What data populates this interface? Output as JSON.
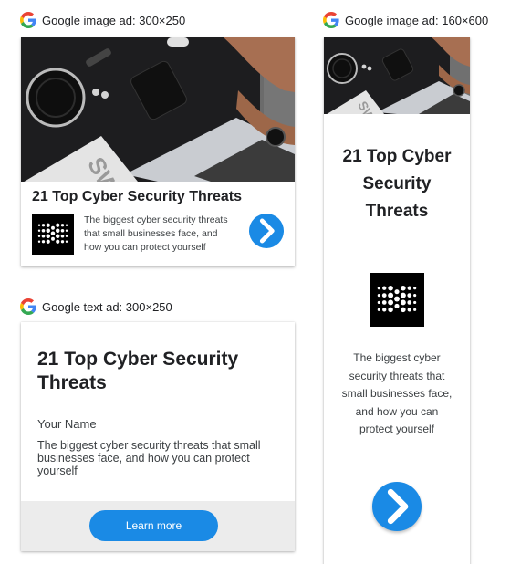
{
  "labels": {
    "image_ad_300": "Google image ad: 300×250",
    "text_ad_300": "Google text ad: 300×250",
    "image_ad_160": "Google image ad: 160×600"
  },
  "ad": {
    "headline": "21 Top Cyber Security Threats",
    "headline_160_lines": [
      "21 Top Cyber",
      "Security",
      "Threats"
    ],
    "description": "The biggest cyber security threats that small businesses face, and how you can protect yourself",
    "description_lines_300": [
      "The biggest cyber security threats",
      "that small businesses face, and",
      "how you can protect yourself"
    ],
    "description_lines_160": [
      "The biggest cyber",
      "security threats that",
      "small businesses face,",
      "and how you can",
      "protect yourself"
    ],
    "business_name": "Your Name",
    "cta_label": "Learn more"
  },
  "icons": {
    "google": "google-g-icon",
    "logo": "brand-logo-icon",
    "cta": "chevron-right-icon"
  },
  "colors": {
    "accent": "#1a8ae5",
    "footer_bg": "#ececec",
    "text_dark": "#202124",
    "text_body": "#3c4043",
    "google_blue": "#4285F4",
    "google_red": "#EA4335",
    "google_yellow": "#FBBC05",
    "google_green": "#34A853"
  }
}
